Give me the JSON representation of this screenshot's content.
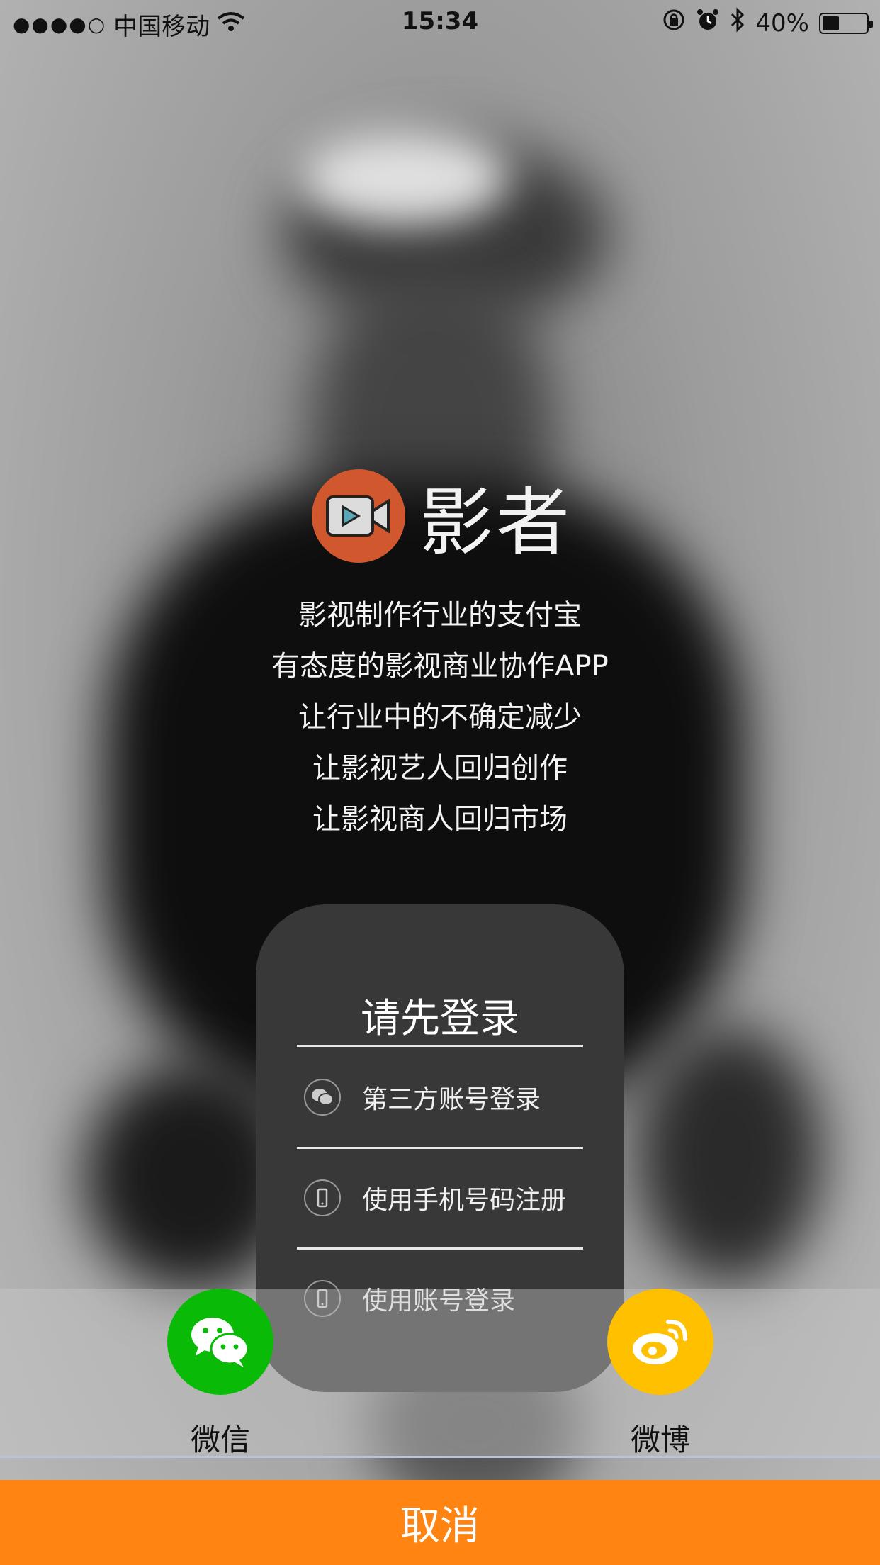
{
  "status_bar": {
    "carrier": "中国移动",
    "time": "15:34",
    "battery": "40%",
    "battery_level": 0.4
  },
  "brand": {
    "app_name": "影者",
    "logo_color": "#d1582e"
  },
  "slogans": [
    "影视制作行业的支付宝",
    "有态度的影视商业协作APP",
    "让行业中的不确定减少",
    "让影视艺人回归创作",
    "让影视商人回归市场"
  ],
  "login_card": {
    "title": "请先登录",
    "options": [
      {
        "label": "第三方账号登录",
        "icon": "wechat-icon"
      },
      {
        "label": "使用手机号码注册",
        "icon": "phone-icon"
      },
      {
        "label": "使用账号登录",
        "icon": "phone-icon"
      }
    ]
  },
  "share": {
    "wechat_label": "微信",
    "weibo_label": "微博",
    "wechat_color": "#09bb07",
    "weibo_color": "#ffc000"
  },
  "cancel_label": "取消",
  "accent_color": "#ff8412"
}
